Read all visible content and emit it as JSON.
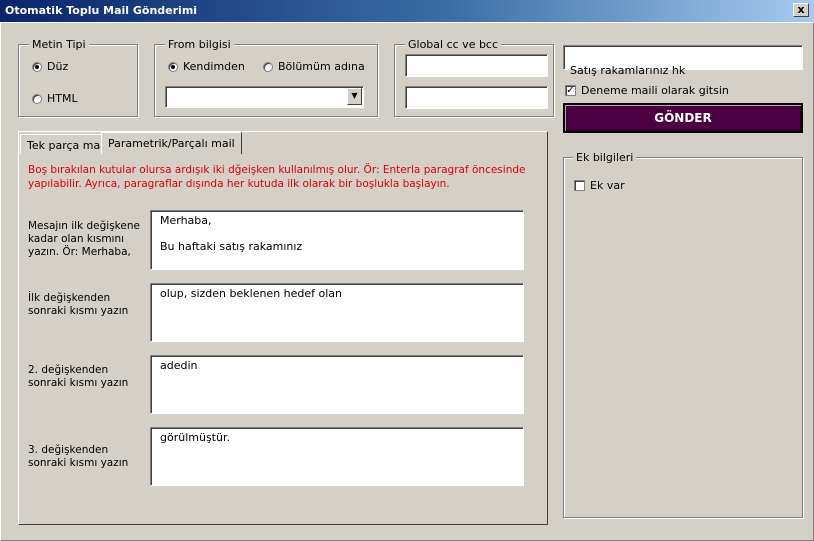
{
  "window": {
    "title": "Otomatik Toplu Mail Gönderimi",
    "close": "x"
  },
  "metin_tipi": {
    "label": "Metin Tipi",
    "options": [
      "Düz",
      "HTML"
    ],
    "selected": "Düz"
  },
  "from_bilgisi": {
    "label": "From bilgisi",
    "options": [
      "Kendimden",
      "Bölümüm adına"
    ],
    "selected": "Kendimden",
    "combo_value": ""
  },
  "global_cc": {
    "label": "Global cc ve bcc",
    "cc_value": "",
    "bcc_value": ""
  },
  "subject": {
    "value": "Satış rakamlarınız hk"
  },
  "test_mail": {
    "label": "Deneme maili olarak gitsin",
    "checked": true
  },
  "send_button": {
    "label": "GÖNDER"
  },
  "tabs": [
    {
      "label": "Tek parça mail"
    },
    {
      "label": "Parametrik/Parçalı mail",
      "active": true
    }
  ],
  "note": "Boş bırakılan kutular olursa ardışık iki dğeişken kullanılmış olur. Ör: Enterla paragraf öncesinde yapılabilir. Ayrıca, paragraflar dışında her kutuda ilk olarak bir boşlukla başlayın.",
  "fields": [
    {
      "label": "Mesajın ilk değişkene kadar olan kısmını yazın. Ör: Merhaba,",
      "value": "Merhaba,\n\nBu haftaki satış rakamınız"
    },
    {
      "label": "İlk değişkenden sonraki kısmı yazın",
      "value": " olup, sizden beklenen hedef olan"
    },
    {
      "label": "2. değişkenden sonraki kısmı yazın",
      "value": " adedin"
    },
    {
      "label": "3. değişkenden sonraki kısmı yazın",
      "value": " görülmüştür."
    }
  ],
  "ek_bilgileri": {
    "label": "Ek bilgileri",
    "ek_var_label": "Ek var",
    "ek_var_checked": false
  },
  "icons": {
    "close": "close-icon",
    "dropdown": "chevron-down-icon",
    "radio": "radio-icon",
    "check": "checkmark-icon"
  }
}
